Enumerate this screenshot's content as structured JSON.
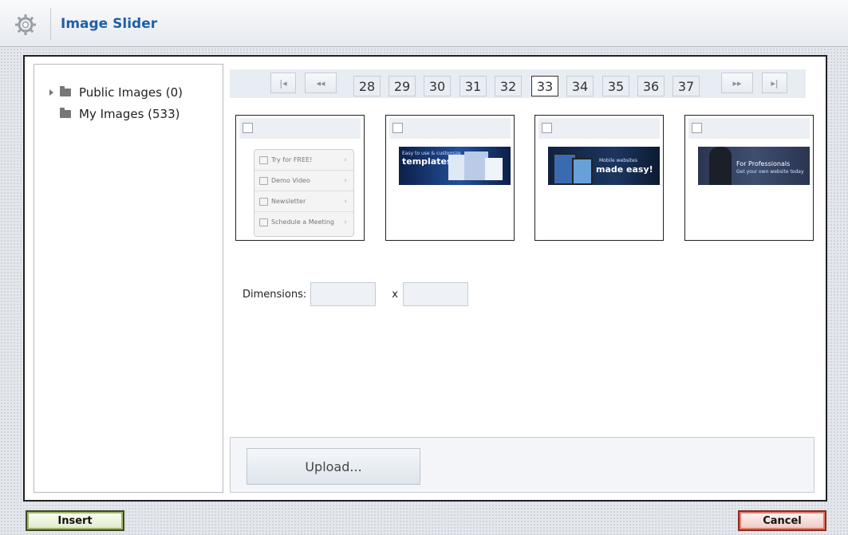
{
  "window": {
    "title": "Image Slider",
    "icon": "gear-icon"
  },
  "tree": {
    "items": [
      {
        "label": "Public Images (0)",
        "expandable": true
      },
      {
        "label": "My Images (533)",
        "expandable": false
      }
    ]
  },
  "pager": {
    "first": "|◂",
    "prev": "◂◂",
    "next": "▸▸",
    "last": "▸|",
    "pages": [
      "28",
      "29",
      "30",
      "31",
      "32",
      "33",
      "34",
      "35",
      "36",
      "37"
    ],
    "current": "33"
  },
  "thumbnails": [
    {
      "type": "menu",
      "rows": [
        "Try for FREE!",
        "Demo Video",
        "Newsletter",
        "Schedule a Meeting"
      ]
    },
    {
      "type": "banner",
      "headline": "templates!",
      "subtext": "Easy to use & customize"
    },
    {
      "type": "banner",
      "headline": "made easy!",
      "subtext": "Mobile websites"
    },
    {
      "type": "banner",
      "headline": "For Professionals",
      "subtext": "Get your own website today"
    }
  ],
  "dimensions": {
    "label": "Dimensions:",
    "separator": "x",
    "width": "",
    "height": ""
  },
  "upload": {
    "label": "Upload..."
  },
  "buttons": {
    "insert": "Insert",
    "cancel": "Cancel"
  },
  "colors": {
    "title": "#1f5fa8",
    "insert_border": "#3c4a25",
    "cancel_border": "#8a2a1f"
  }
}
